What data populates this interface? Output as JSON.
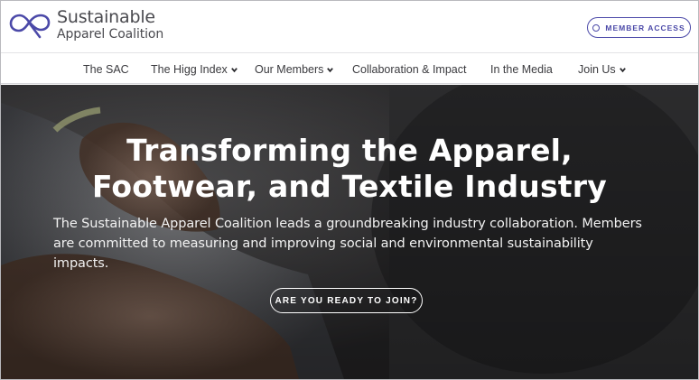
{
  "brand": {
    "name_line1": "Sustainable",
    "name_line2": "Apparel Coalition",
    "logo_icon": "infinity-loop-icon",
    "accent_color": "#4b49a8"
  },
  "header": {
    "member_access_label": "MEMBER ACCESS",
    "member_access_icon": "circle-icon"
  },
  "nav": {
    "items": [
      {
        "label": "The SAC",
        "has_dropdown": false
      },
      {
        "label": "The Higg Index",
        "has_dropdown": true
      },
      {
        "label": "Our Members",
        "has_dropdown": true
      },
      {
        "label": "Collaboration & Impact",
        "has_dropdown": false
      },
      {
        "label": "In the Media",
        "has_dropdown": false
      },
      {
        "label": "Join Us",
        "has_dropdown": true
      }
    ]
  },
  "hero": {
    "title_line1": "Transforming the Apparel,",
    "title_line2": "Footwear, and Textile Industry",
    "subtitle": "The Sustainable Apparel Coalition leads a groundbreaking industry collaboration. Members are committed to measuring and improving social and environmental sustainability impacts.",
    "cta_label": "ARE YOU READY TO JOIN?"
  }
}
